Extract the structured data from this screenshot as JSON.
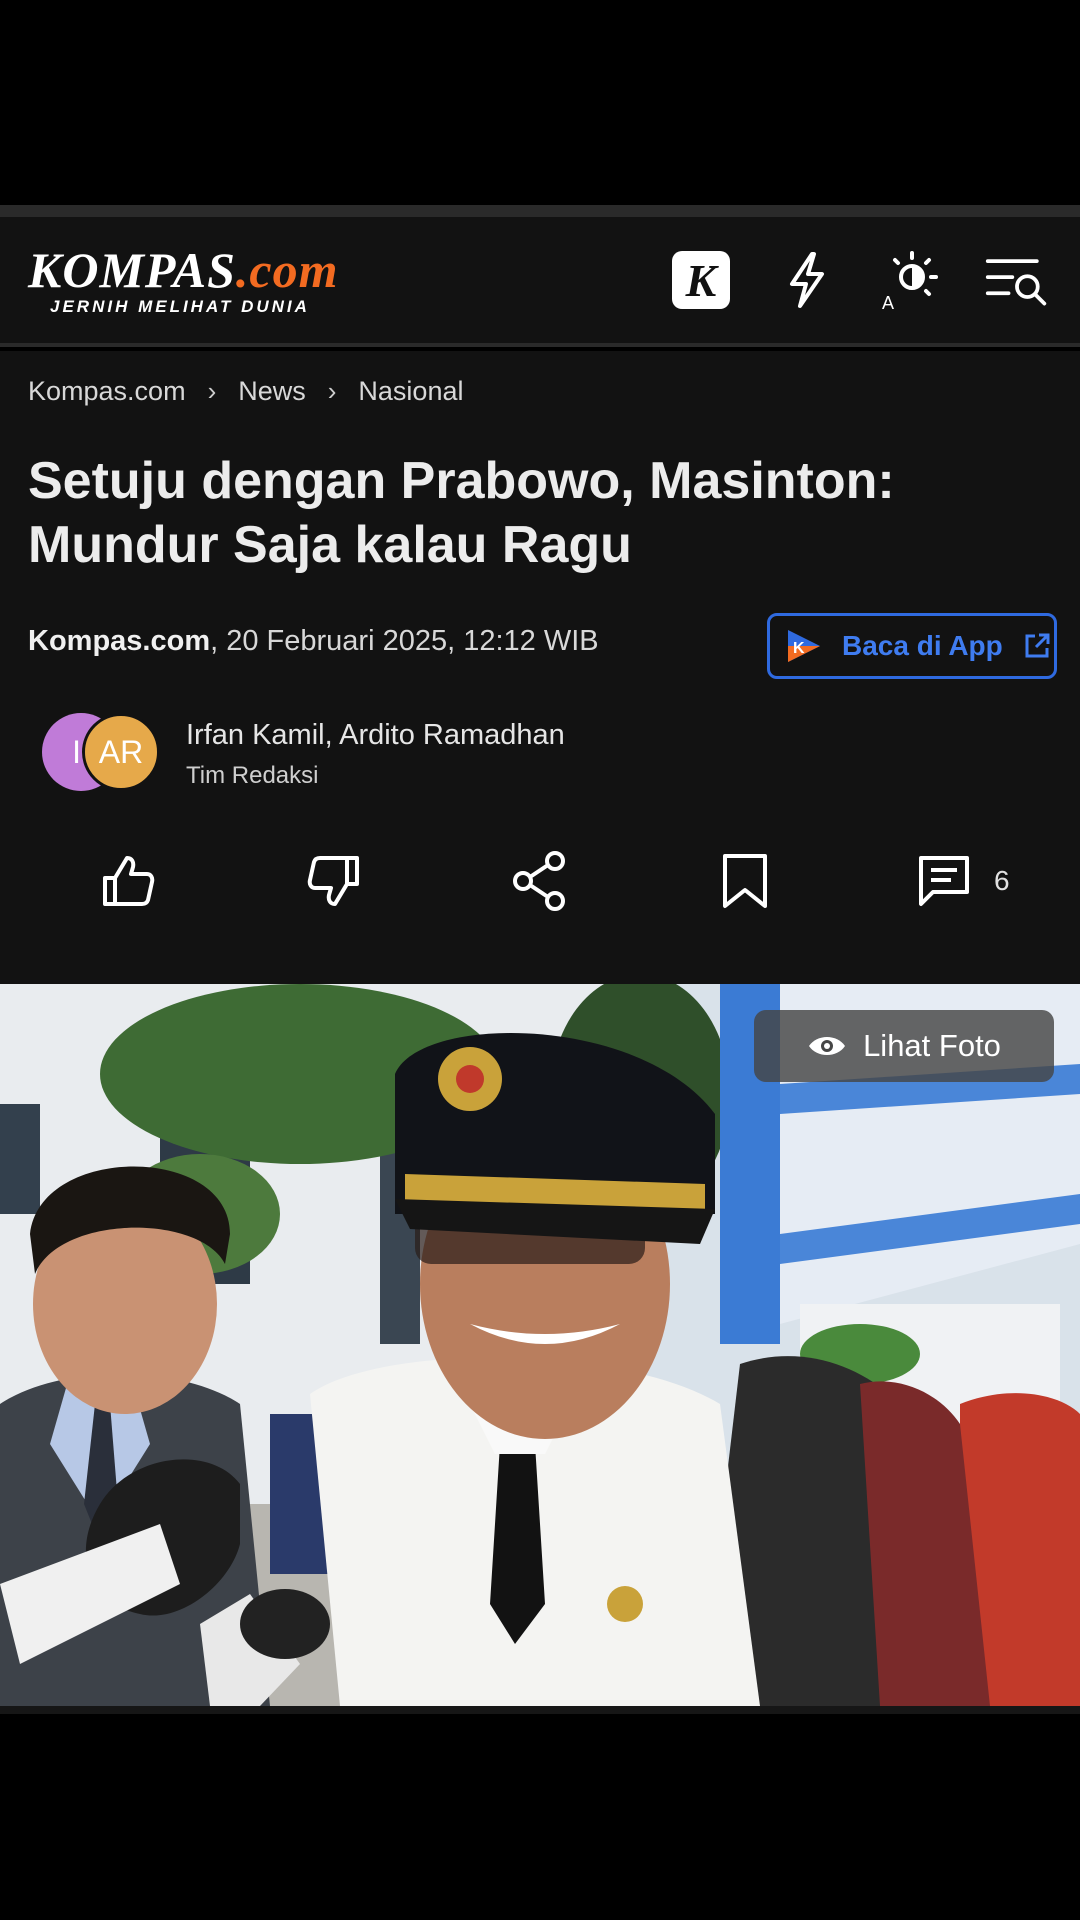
{
  "header": {
    "logo_main": "KOMPAS",
    "logo_suffix": ".com",
    "logo_tagline": "JERNIH MELIHAT DUNIA",
    "k_icon_letter": "K",
    "icons": [
      "kompas-k-icon",
      "bolt-icon",
      "theme-toggle-icon",
      "menu-search-icon"
    ]
  },
  "breadcrumb": {
    "items": [
      "Kompas.com",
      "News",
      "Nasional"
    ],
    "separator": "›"
  },
  "article": {
    "title": "Setuju dengan Prabowo, Masinton: Mundur Saja kalau Ragu",
    "source": "Kompas.com",
    "date": ", 20 Februari 2025, 12:12 WIB",
    "app_button_label": "Baca di App",
    "authors": "Irfan Kamil, Ardito Ramadhan",
    "author_role": "Tim Redaksi",
    "avatar_1": "II",
    "avatar_2": "AR",
    "comment_count": "6"
  },
  "photo": {
    "view_label": "Lihat Foto"
  },
  "colors": {
    "background": "#121212",
    "accent_orange": "#f36b21",
    "app_blue": "#2f6ae0",
    "avatar_purple": "#c07bd8",
    "avatar_orange": "#e6a94a"
  }
}
